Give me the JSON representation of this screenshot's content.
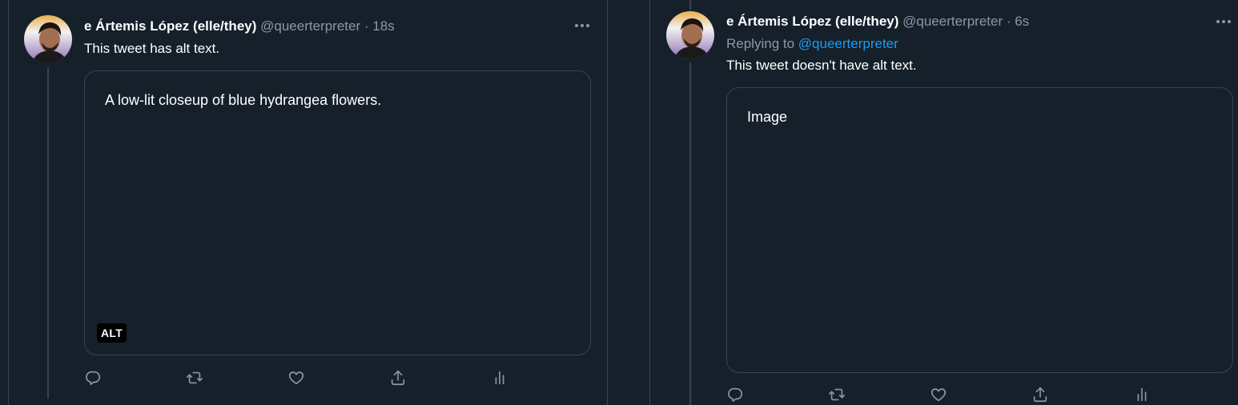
{
  "colors": {
    "background": "#15202b",
    "border": "#38444d",
    "secondary_text": "#8b98a5",
    "link": "#1d9bf0",
    "primary_text": "#ffffff"
  },
  "tweets": [
    {
      "author_name": "e Ártemis López (elle/they)",
      "handle": "@queerterpreter",
      "separator": "·",
      "time": "18s",
      "replying_prefix": "",
      "replying_handle": "",
      "text": "This tweet has alt text.",
      "media_text": "A low-lit closeup of blue hydrangea flowers.",
      "alt_badge": "ALT",
      "more_icon": "more-horizontal-icon",
      "action_icons": [
        "reply-icon",
        "retweet-icon",
        "like-icon",
        "share-icon",
        "analytics-icon"
      ]
    },
    {
      "author_name": "e Ártemis López (elle/they)",
      "handle": "@queerterpreter",
      "separator": "·",
      "time": "6s",
      "replying_prefix": "Replying to",
      "replying_handle": "@queerterpreter",
      "text": "This tweet doesn't have alt text.",
      "media_text": "Image",
      "alt_badge": "",
      "more_icon": "more-horizontal-icon",
      "action_icons": [
        "reply-icon",
        "retweet-icon",
        "like-icon",
        "share-icon",
        "analytics-icon"
      ]
    }
  ]
}
